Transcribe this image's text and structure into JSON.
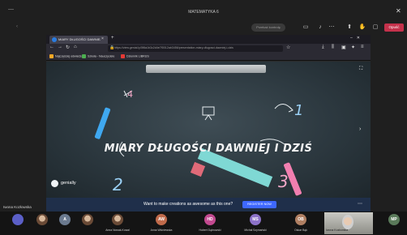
{
  "window": {
    "title": "MATEMATYKA 6",
    "minimize_icon": "minimize-icon",
    "close_icon": "close-icon"
  },
  "toolbar": {
    "pill_label": "Przekaż kontrolę",
    "icons": [
      "camera-icon",
      "microphone-icon",
      "more-icon",
      "share-icon",
      "raise-hand-icon",
      "chat-icon"
    ],
    "leave_label": "Opuść",
    "leave_color": "#c4314b"
  },
  "browser": {
    "tab_title": "MIARY DŁUGOŚCI DAWNIEJ I ...",
    "tab_close": "×",
    "new_tab": "+",
    "url": "https://view.genial.ly/5f8a1b3c2d4e7f0012ab3456/presentation-miary-dlugosci-dawniej-i-dzis",
    "bookmarks": [
      "Najczęściej odwiedzane",
      "Szkoła - Nauczyciele",
      "Dziennik LIBRUS"
    ],
    "bookmark_colors": [
      "#f9a825",
      "#4caf50",
      "#e53935"
    ]
  },
  "slide": {
    "title": "MIARY DŁUGOŚCI DAWNIEJ I DZIŚ",
    "numerals": [
      "1",
      "2",
      "3",
      "4"
    ],
    "logo_text": "genially"
  },
  "banner": {
    "text": "Want to make creations as awesome as this one?",
    "button_label": "REGISTER NOW",
    "accent_color": "#3e68ff"
  },
  "presenter_name": "Iwona Kozłowska",
  "participants": [
    {
      "initials": "",
      "name": "",
      "color": "#5b5fc7"
    },
    {
      "initials": "",
      "name": "",
      "color": "#7a5a48"
    },
    {
      "initials": "A",
      "name": "",
      "color": "#6b7a8f"
    },
    {
      "initials": "",
      "name": "",
      "color": "#8f6a55"
    },
    {
      "initials": "",
      "name": "Anna Nowak-Kowal",
      "color": "#9a7a55"
    },
    {
      "initials": "AW",
      "name": "Anna Wiśniewska",
      "color": "#c06a4a"
    },
    {
      "initials": "HD",
      "name": "Hubert Dąbrowski",
      "color": "#c2498f"
    },
    {
      "initials": "MS",
      "name": "Michał Szymański",
      "color": "#8c72c8"
    },
    {
      "initials": "OB",
      "name": "Oskar Bąk",
      "color": "#b07f62"
    },
    {
      "initials": "MP",
      "name": "",
      "color": "#5a7a5a"
    }
  ],
  "self_view": {
    "name": "Iwona Kozłowska"
  }
}
